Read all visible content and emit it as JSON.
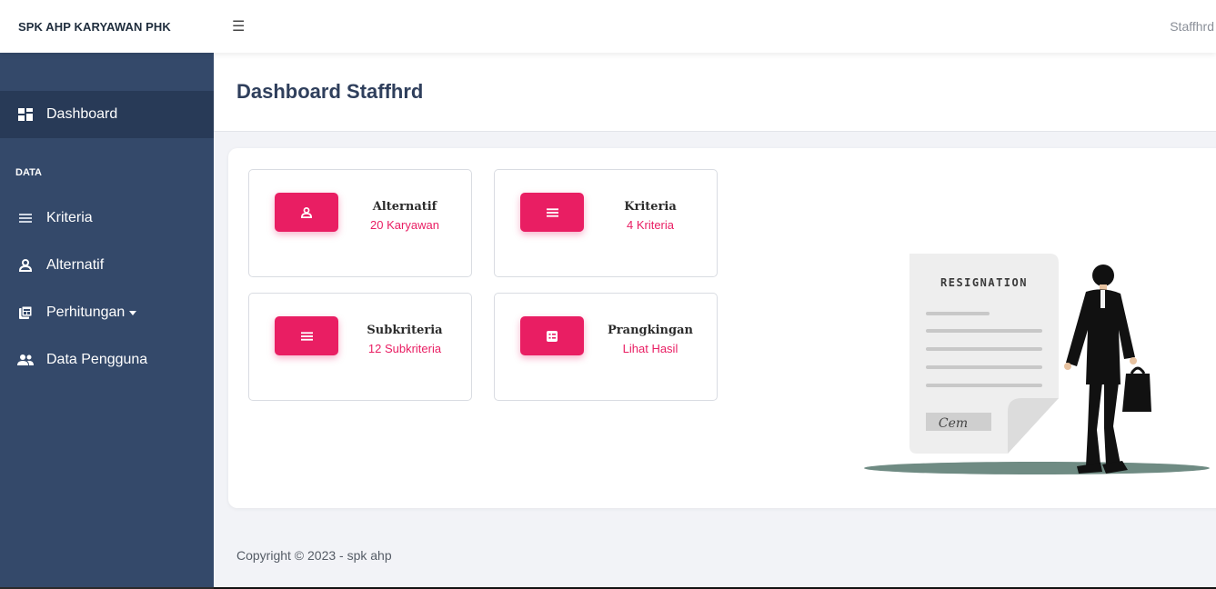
{
  "navbar": {
    "brand": "SPK AHP KARYAWAN PHK",
    "menu_icon": "hamburger-icon",
    "user": "Staffhrd"
  },
  "sidebar": {
    "heading": "DATA",
    "items": [
      {
        "label": "Dashboard",
        "icon": "dashboard-icon",
        "active": true
      },
      {
        "label": "Kriteria",
        "icon": "list-icon"
      },
      {
        "label": "Alternatif",
        "icon": "user-icon"
      },
      {
        "label": "Perhitungan",
        "icon": "calculator-icon",
        "dropdown": true
      },
      {
        "label": "Data Pengguna",
        "icon": "users-icon"
      }
    ]
  },
  "page": {
    "title": "Dashboard Staffhrd"
  },
  "stats": [
    {
      "title": "Alternatif",
      "value": "20 Karyawan",
      "icon": "user-icon"
    },
    {
      "title": "Kriteria",
      "value": "4 Kriteria",
      "icon": "list-icon"
    },
    {
      "title": "Subkriteria",
      "value": "12 Subkriteria",
      "icon": "list-icon"
    },
    {
      "title": "Prangkingan",
      "value": "Lihat Hasil",
      "icon": "table-icon"
    }
  ],
  "illustration": {
    "heading": "RESIGNATION",
    "signature": "Cem"
  },
  "footer": {
    "text": "Copyright © 2023 - spk ahp"
  },
  "colors": {
    "sidebar": "#34496a",
    "sidebar_active": "#283a57",
    "accent": "#e91e63",
    "title": "#2f3f5c"
  }
}
